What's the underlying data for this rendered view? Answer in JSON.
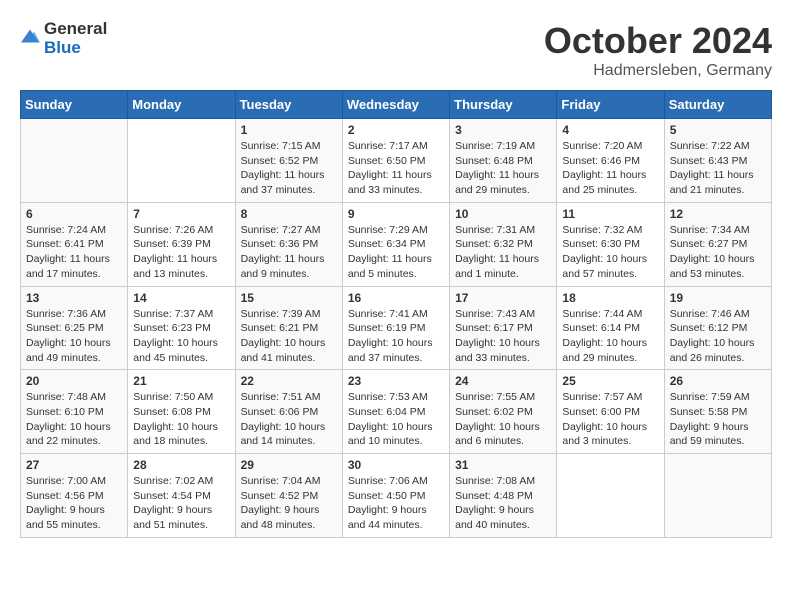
{
  "header": {
    "logo_general": "General",
    "logo_blue": "Blue",
    "month": "October 2024",
    "location": "Hadmersleben, Germany"
  },
  "weekdays": [
    "Sunday",
    "Monday",
    "Tuesday",
    "Wednesday",
    "Thursday",
    "Friday",
    "Saturday"
  ],
  "weeks": [
    [
      {
        "day": "",
        "info": ""
      },
      {
        "day": "",
        "info": ""
      },
      {
        "day": "1",
        "info": "Sunrise: 7:15 AM\nSunset: 6:52 PM\nDaylight: 11 hours and 37 minutes."
      },
      {
        "day": "2",
        "info": "Sunrise: 7:17 AM\nSunset: 6:50 PM\nDaylight: 11 hours and 33 minutes."
      },
      {
        "day": "3",
        "info": "Sunrise: 7:19 AM\nSunset: 6:48 PM\nDaylight: 11 hours and 29 minutes."
      },
      {
        "day": "4",
        "info": "Sunrise: 7:20 AM\nSunset: 6:46 PM\nDaylight: 11 hours and 25 minutes."
      },
      {
        "day": "5",
        "info": "Sunrise: 7:22 AM\nSunset: 6:43 PM\nDaylight: 11 hours and 21 minutes."
      }
    ],
    [
      {
        "day": "6",
        "info": "Sunrise: 7:24 AM\nSunset: 6:41 PM\nDaylight: 11 hours and 17 minutes."
      },
      {
        "day": "7",
        "info": "Sunrise: 7:26 AM\nSunset: 6:39 PM\nDaylight: 11 hours and 13 minutes."
      },
      {
        "day": "8",
        "info": "Sunrise: 7:27 AM\nSunset: 6:36 PM\nDaylight: 11 hours and 9 minutes."
      },
      {
        "day": "9",
        "info": "Sunrise: 7:29 AM\nSunset: 6:34 PM\nDaylight: 11 hours and 5 minutes."
      },
      {
        "day": "10",
        "info": "Sunrise: 7:31 AM\nSunset: 6:32 PM\nDaylight: 11 hours and 1 minute."
      },
      {
        "day": "11",
        "info": "Sunrise: 7:32 AM\nSunset: 6:30 PM\nDaylight: 10 hours and 57 minutes."
      },
      {
        "day": "12",
        "info": "Sunrise: 7:34 AM\nSunset: 6:27 PM\nDaylight: 10 hours and 53 minutes."
      }
    ],
    [
      {
        "day": "13",
        "info": "Sunrise: 7:36 AM\nSunset: 6:25 PM\nDaylight: 10 hours and 49 minutes."
      },
      {
        "day": "14",
        "info": "Sunrise: 7:37 AM\nSunset: 6:23 PM\nDaylight: 10 hours and 45 minutes."
      },
      {
        "day": "15",
        "info": "Sunrise: 7:39 AM\nSunset: 6:21 PM\nDaylight: 10 hours and 41 minutes."
      },
      {
        "day": "16",
        "info": "Sunrise: 7:41 AM\nSunset: 6:19 PM\nDaylight: 10 hours and 37 minutes."
      },
      {
        "day": "17",
        "info": "Sunrise: 7:43 AM\nSunset: 6:17 PM\nDaylight: 10 hours and 33 minutes."
      },
      {
        "day": "18",
        "info": "Sunrise: 7:44 AM\nSunset: 6:14 PM\nDaylight: 10 hours and 29 minutes."
      },
      {
        "day": "19",
        "info": "Sunrise: 7:46 AM\nSunset: 6:12 PM\nDaylight: 10 hours and 26 minutes."
      }
    ],
    [
      {
        "day": "20",
        "info": "Sunrise: 7:48 AM\nSunset: 6:10 PM\nDaylight: 10 hours and 22 minutes."
      },
      {
        "day": "21",
        "info": "Sunrise: 7:50 AM\nSunset: 6:08 PM\nDaylight: 10 hours and 18 minutes."
      },
      {
        "day": "22",
        "info": "Sunrise: 7:51 AM\nSunset: 6:06 PM\nDaylight: 10 hours and 14 minutes."
      },
      {
        "day": "23",
        "info": "Sunrise: 7:53 AM\nSunset: 6:04 PM\nDaylight: 10 hours and 10 minutes."
      },
      {
        "day": "24",
        "info": "Sunrise: 7:55 AM\nSunset: 6:02 PM\nDaylight: 10 hours and 6 minutes."
      },
      {
        "day": "25",
        "info": "Sunrise: 7:57 AM\nSunset: 6:00 PM\nDaylight: 10 hours and 3 minutes."
      },
      {
        "day": "26",
        "info": "Sunrise: 7:59 AM\nSunset: 5:58 PM\nDaylight: 9 hours and 59 minutes."
      }
    ],
    [
      {
        "day": "27",
        "info": "Sunrise: 7:00 AM\nSunset: 4:56 PM\nDaylight: 9 hours and 55 minutes."
      },
      {
        "day": "28",
        "info": "Sunrise: 7:02 AM\nSunset: 4:54 PM\nDaylight: 9 hours and 51 minutes."
      },
      {
        "day": "29",
        "info": "Sunrise: 7:04 AM\nSunset: 4:52 PM\nDaylight: 9 hours and 48 minutes."
      },
      {
        "day": "30",
        "info": "Sunrise: 7:06 AM\nSunset: 4:50 PM\nDaylight: 9 hours and 44 minutes."
      },
      {
        "day": "31",
        "info": "Sunrise: 7:08 AM\nSunset: 4:48 PM\nDaylight: 9 hours and 40 minutes."
      },
      {
        "day": "",
        "info": ""
      },
      {
        "day": "",
        "info": ""
      }
    ]
  ]
}
